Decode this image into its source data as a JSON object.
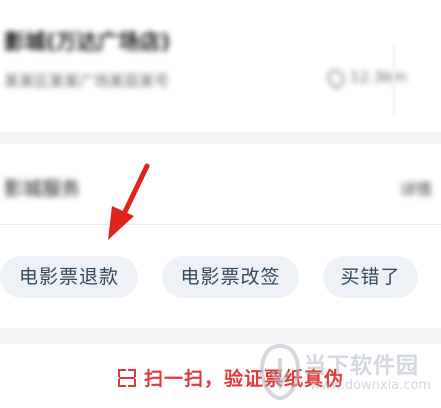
{
  "cinema": {
    "name": "影城(万达广场店)",
    "address": "某某区某某广场某层某号",
    "distance": "12.3km"
  },
  "row": {
    "label": "影城服务",
    "right": "详情"
  },
  "chips": {
    "refund": "电影票退款",
    "change": "电影票改签",
    "wrong": "买错了"
  },
  "bottom": {
    "scan_text": "扫一扫，验证票纸真伪"
  },
  "watermark": {
    "text": "当下软件园",
    "url": "www.downxia.com"
  },
  "colors": {
    "accent": "#e03b3b",
    "chip_bg": "#eef2f7",
    "chip_text": "#34495e"
  }
}
